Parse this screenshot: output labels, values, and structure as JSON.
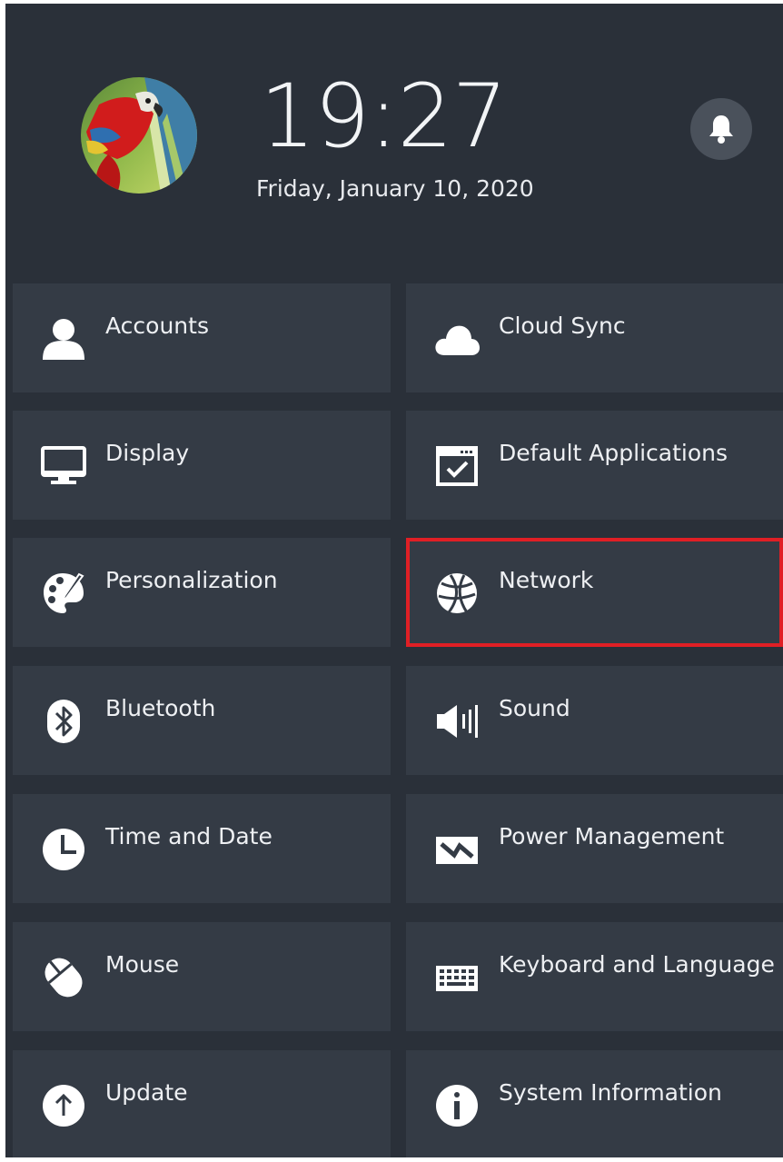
{
  "header": {
    "time": "19:27",
    "date": "Friday, January 10, 2020",
    "avatar_icon": "parrot-avatar",
    "notification_icon": "bell-icon"
  },
  "tiles": [
    {
      "label": "Accounts",
      "icon": "user-icon"
    },
    {
      "label": "Cloud Sync",
      "icon": "cloud-icon"
    },
    {
      "label": "Display",
      "icon": "monitor-icon"
    },
    {
      "label": "Default Applications",
      "icon": "default-apps-icon"
    },
    {
      "label": "Personalization",
      "icon": "palette-icon"
    },
    {
      "label": "Network",
      "icon": "globe-icon",
      "selected": true
    },
    {
      "label": "Bluetooth",
      "icon": "bluetooth-icon"
    },
    {
      "label": "Sound",
      "icon": "speaker-icon"
    },
    {
      "label": "Time and Date",
      "icon": "clock-icon"
    },
    {
      "label": "Power Management",
      "icon": "power-icon"
    },
    {
      "label": "Mouse",
      "icon": "mouse-icon"
    },
    {
      "label": "Keyboard and Language",
      "icon": "keyboard-icon"
    },
    {
      "label": "Update",
      "icon": "update-icon"
    },
    {
      "label": "System Information",
      "icon": "info-icon"
    }
  ],
  "colors": {
    "background": "#2a3039",
    "tile": "#343b45",
    "selection": "#e01f25",
    "text": "#eef0f3"
  }
}
